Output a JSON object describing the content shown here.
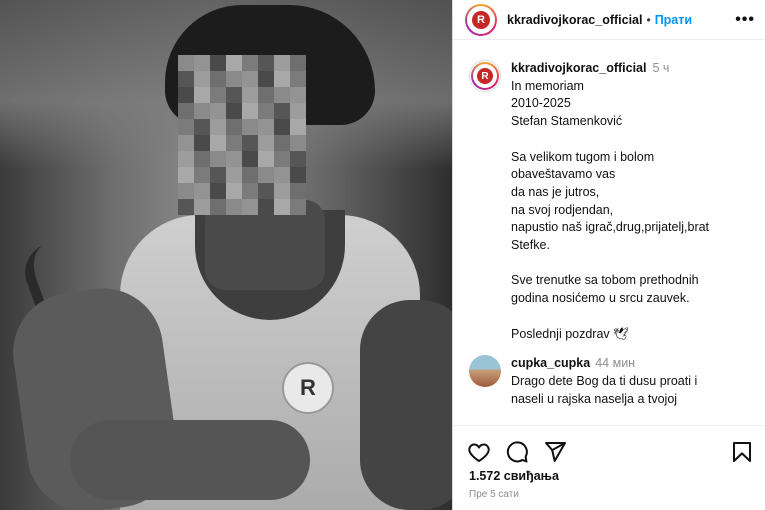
{
  "post": {
    "username": "kkradivojkorac_official",
    "follow_label": "Прати",
    "more_label": "•••",
    "logo_letter": "R",
    "caption_time": "5 ч",
    "caption_lines": [
      "In memoriam",
      "2010-2025",
      "Stefan Stamenković",
      "",
      "Sa velikom tugom i bolom",
      "obaveštavamo vas",
      "da nas je jutros,",
      "na svoj rodjendan,",
      "napustio naš igrač,drug,prijatelj,brat",
      "Stefke.",
      "",
      "Sve trenutke sa tobom prethodnih",
      "godina nosićemo u srcu zauvek.",
      "",
      "Poslednji pozdrav 🕊"
    ],
    "likes": "1.572 свиђања",
    "posted_ago": "Пре 5 сати"
  },
  "comment": {
    "username": "cupka_cupka",
    "time": "44 мин",
    "lines": [
      "Drago dete Bog da ti dusu proati i",
      "naseli u rajska naselja a tvojoj"
    ]
  },
  "icons": {
    "like": "heart-icon",
    "comment": "comment-icon",
    "share": "send-icon",
    "save": "bookmark-icon",
    "more": "more-dots-icon"
  },
  "colors": {
    "accent": "#0095f6",
    "muted": "#8e8e8e",
    "logo": "#c62828"
  }
}
